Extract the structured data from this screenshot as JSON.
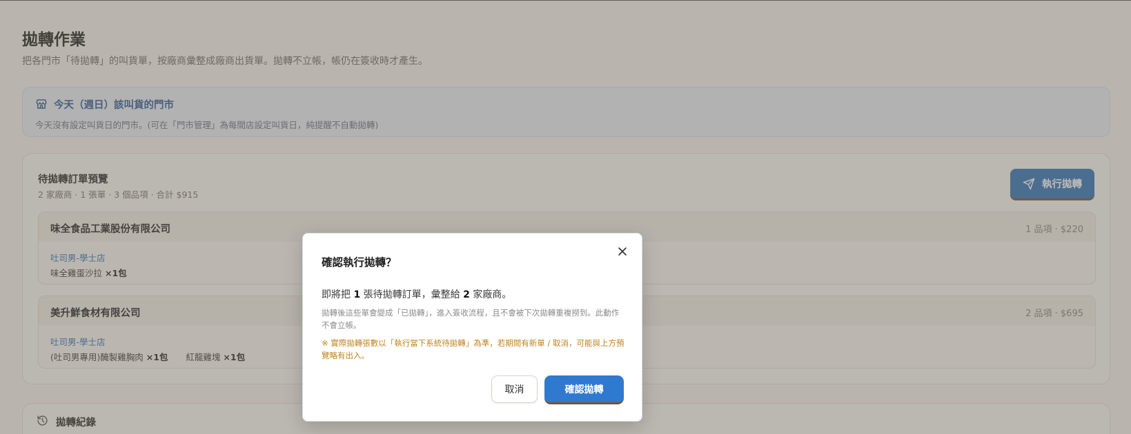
{
  "page": {
    "title": "拋轉作業",
    "subtitle": "把各門市「待拋轉」的叫貨單，按廠商彙整成廠商出貨單。拋轉不立帳，帳仍在簽收時才產生。"
  },
  "today_box": {
    "icon": "store-icon",
    "title": "今天（週日）該叫貨的門市",
    "description": "今天沒有設定叫貨日的門市。(可在「門市管理」為每間店設定叫貨日，純提醒不自動拋轉)"
  },
  "preview": {
    "title": "待拋轉訂單預覽",
    "summary": "2 家廠商 · 1 張單 · 3 個品項 · 合計 $915",
    "execute_label": "執行拋轉",
    "execute_icon": "send-icon",
    "vendors": [
      {
        "name": "味全食品工業股份有限公司",
        "meta": "1 品項 · $220",
        "store": "吐司男-學士店",
        "items": [
          {
            "name": "味全雞蛋沙拉",
            "qty": "×1包"
          }
        ]
      },
      {
        "name": "美升鮮食材有限公司",
        "meta": "2 品項 · $695",
        "store": "吐司男-學士店",
        "items": [
          {
            "name": "(吐司男專用)醃製雞胸肉",
            "qty": "×1包"
          },
          {
            "name": "紅龍雞塊",
            "qty": "×1包"
          }
        ]
      }
    ]
  },
  "history": {
    "icon": "history-icon",
    "title": "拋轉紀錄"
  },
  "modal": {
    "title": "確認執行拋轉？",
    "main_prefix": "即將把 ",
    "order_count": "1",
    "main_middle": " 張待拋轉訂單，彙整給 ",
    "vendor_count": "2",
    "main_suffix": " 家廠商。",
    "note": "拋轉後這些單會變成「已拋轉」，進入簽收流程，且不會被下次拋轉重複撈到。此動作不會立帳。",
    "warning": "※ 實際拋轉張數以「執行當下系統待拋轉」為準，若期間有新單 / 取消，可能與上方預覽略有出入。",
    "cancel_label": "取消",
    "confirm_label": "確認拋轉",
    "close_icon": "close-icon"
  },
  "colors": {
    "accent": "#2f72b8",
    "warning": "#c08322",
    "link": "#2f72b8"
  }
}
